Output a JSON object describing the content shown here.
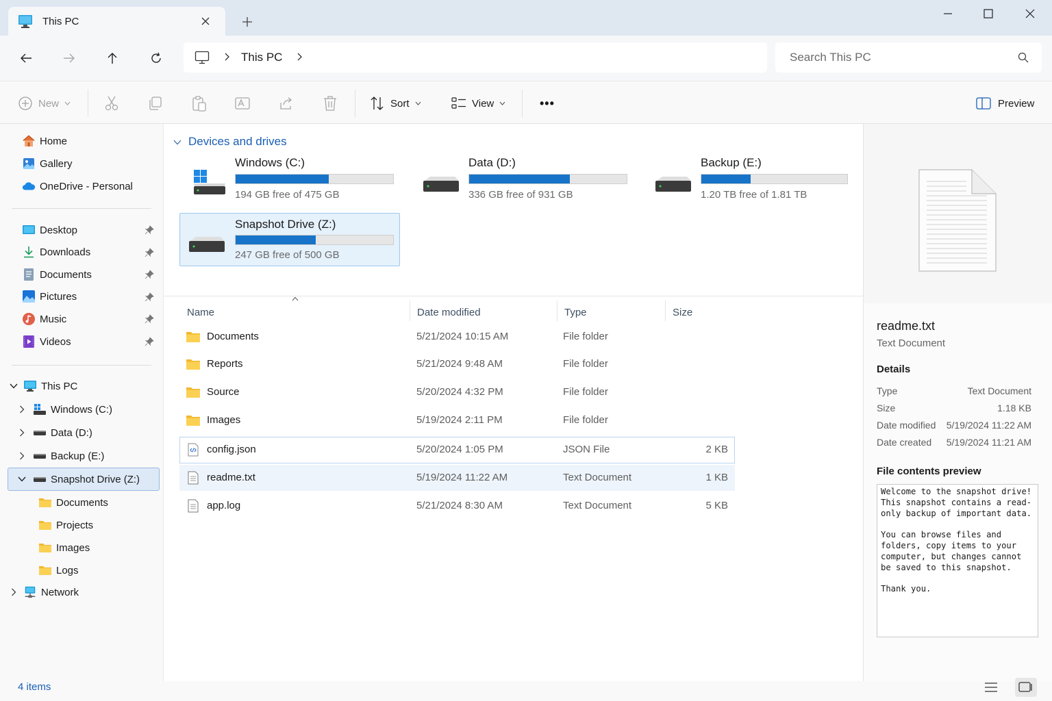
{
  "window": {
    "tab_title": "This PC",
    "tab_icon": "monitor-icon",
    "new_tab_icon": "plus-icon",
    "controls": [
      "minimize-icon",
      "maximize-icon",
      "close-icon"
    ]
  },
  "address": {
    "crumbs": [
      "This PC"
    ],
    "search_placeholder": "Search This PC"
  },
  "toolbar": {
    "new_label": "New",
    "sort_label": "Sort",
    "view_label": "View",
    "more_label": "•••",
    "preview_label": "Preview",
    "disabled_icons": [
      "cut-icon",
      "copy-icon",
      "paste-icon",
      "rename-icon",
      "share-icon",
      "delete-icon"
    ]
  },
  "sidebar": {
    "quick": [
      {
        "label": "Home",
        "icon": "home-icon"
      },
      {
        "label": "Gallery",
        "icon": "gallery-icon"
      },
      {
        "label": "OneDrive - Personal",
        "icon": "onedrive-icon"
      }
    ],
    "pinned": [
      {
        "label": "Desktop",
        "icon": "desktop-icon"
      },
      {
        "label": "Downloads",
        "icon": "downloads-icon"
      },
      {
        "label": "Documents",
        "icon": "documents-icon"
      },
      {
        "label": "Pictures",
        "icon": "pictures-icon"
      },
      {
        "label": "Music",
        "icon": "music-icon"
      },
      {
        "label": "Videos",
        "icon": "videos-icon"
      }
    ],
    "this_pc": "This PC",
    "drives": [
      "Windows (C:)",
      "Data (D:)",
      "Backup (E:)",
      "Snapshot Drive (Z:)"
    ],
    "snapshot_folders": [
      "Documents",
      "Projects",
      "Images",
      "Logs"
    ],
    "network": "Network"
  },
  "main": {
    "section_title": "Devices and drives",
    "drives": [
      {
        "name": "Windows (C:)",
        "free": "194 GB free of 475 GB",
        "used_fraction": 0.59
      },
      {
        "name": "Data (D:)",
        "free": "336 GB free of 931 GB",
        "used_fraction": 0.64
      },
      {
        "name": "Backup (E:)",
        "free": "1.20 TB free of 1.81 TB",
        "used_fraction": 0.34
      },
      {
        "name": "Snapshot Drive (Z:)",
        "free": "247 GB free of 500 GB",
        "used_fraction": 0.51
      }
    ],
    "columns": {
      "name": "Name",
      "date": "Date modified",
      "type": "Type",
      "size": "Size"
    },
    "files": [
      {
        "name": "Documents",
        "date": "5/21/2024 10:15 AM",
        "type": "File folder",
        "size": "",
        "icon": "folder-icon"
      },
      {
        "name": "Reports",
        "date": "5/21/2024 9:48 AM",
        "type": "File folder",
        "size": "",
        "icon": "folder-icon"
      },
      {
        "name": "Source",
        "date": "5/20/2024 4:32 PM",
        "type": "File folder",
        "size": "",
        "icon": "folder-icon"
      },
      {
        "name": "Images",
        "date": "5/19/2024 2:11 PM",
        "type": "File folder",
        "size": "",
        "icon": "folder-icon"
      },
      {
        "name": "config.json",
        "date": "5/20/2024 1:05 PM",
        "type": "JSON File",
        "size": "2 KB",
        "icon": "json-file-icon"
      },
      {
        "name": "readme.txt",
        "date": "5/19/2024 11:22 AM",
        "type": "Text Document",
        "size": "1 KB",
        "icon": "text-file-icon"
      },
      {
        "name": "app.log",
        "date": "5/21/2024 8:30 AM",
        "type": "Text Document",
        "size": "5 KB",
        "icon": "text-file-icon"
      }
    ]
  },
  "preview": {
    "file_name": "readme.txt",
    "file_type": "Text Document",
    "details_heading": "Details",
    "details": [
      {
        "key": "Type",
        "value": "Text Document"
      },
      {
        "key": "Size",
        "value": "1.18 KB"
      },
      {
        "key": "Date modified",
        "value": "5/19/2024 11:22 AM"
      },
      {
        "key": "Date created",
        "value": "5/19/2024 11:21 AM"
      }
    ],
    "contents_heading": "File contents preview",
    "contents": "Welcome to the snapshot drive!\nThis snapshot contains a read-only backup of important data.\n\nYou can browse files and folders, copy items to your computer, but changes cannot be saved to this snapshot.\n\nThank you."
  },
  "status": {
    "items": "4 items"
  },
  "colors": {
    "accent": "#1a5fb4",
    "drive_bar": "#1774c9",
    "selection": "#dde9f7",
    "folder": "#f8c948"
  }
}
